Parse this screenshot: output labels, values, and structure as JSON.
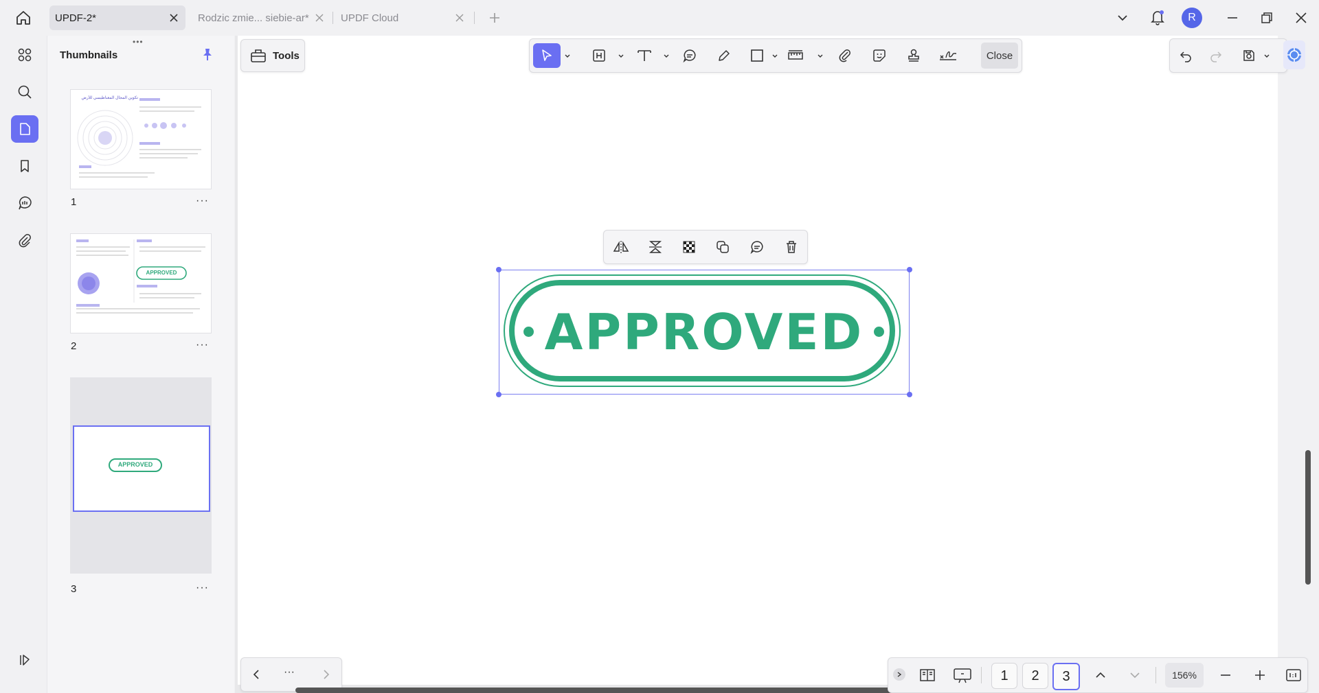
{
  "tabs": [
    {
      "label": "UPDF-2*",
      "active": true
    },
    {
      "label": "Rodzic zmie... siebie-ar*",
      "active": false
    },
    {
      "label": "UPDF Cloud",
      "active": false
    }
  ],
  "user": {
    "avatar_initial": "R",
    "avatar_color": "#5566e8"
  },
  "panel": {
    "title": "Thumbnails"
  },
  "thumbnails": [
    {
      "number": "1",
      "more": "···",
      "heading": "تكوين المجال المغناطيسي للأرض"
    },
    {
      "number": "2",
      "more": "···",
      "stamp": "APPROVED"
    },
    {
      "number": "3",
      "more": "···",
      "stamp": "APPROVED"
    }
  ],
  "toolbar": {
    "tools_label": "Tools",
    "close_label": "Close"
  },
  "stamp": {
    "text": "APPROVED",
    "color": "#2fa97c"
  },
  "bottom": {
    "more": "···",
    "pages": [
      "1",
      "2",
      "3"
    ],
    "current_page": "3",
    "zoom": "156%"
  },
  "colors": {
    "accent": "#6a6ff2",
    "stamp_green": "#2fa97c"
  }
}
